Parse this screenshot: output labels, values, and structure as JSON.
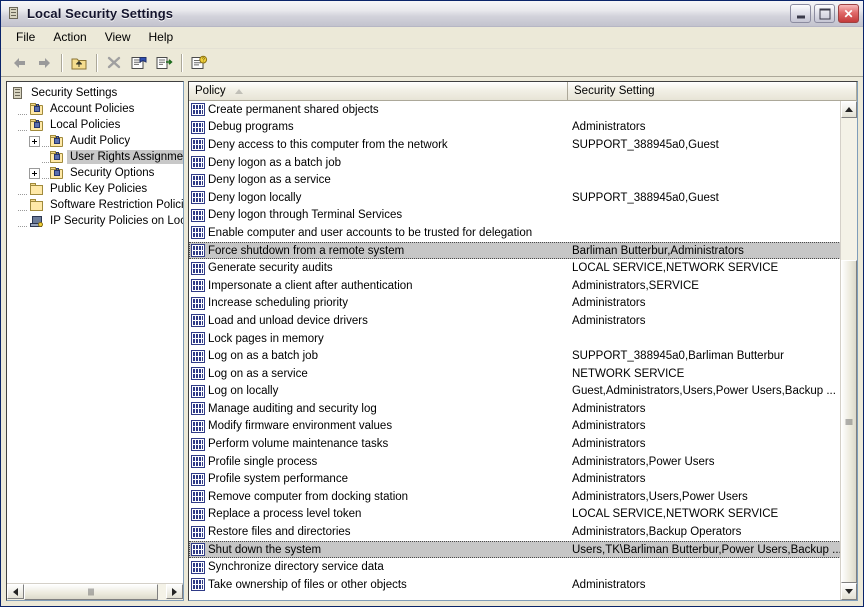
{
  "window": {
    "title": "Local Security Settings",
    "icon": "security-settings-icon",
    "buttons": {
      "minimize": "_",
      "maximize": "□",
      "close": "✕"
    }
  },
  "menu": {
    "items": [
      "File",
      "Action",
      "View",
      "Help"
    ]
  },
  "toolbar": {
    "items": [
      {
        "name": "back-icon",
        "label": "Back"
      },
      {
        "name": "forward-icon",
        "label": "Forward"
      },
      {
        "name": "up-one-level-icon",
        "label": "Up One Level"
      },
      {
        "name": "delete-icon",
        "label": "Delete"
      },
      {
        "name": "properties-icon",
        "label": "Properties"
      },
      {
        "name": "export-list-icon",
        "label": "Export List"
      },
      {
        "name": "help-icon",
        "label": "Help"
      }
    ]
  },
  "tree": {
    "nodes": [
      {
        "label": "Security Settings",
        "level": 0,
        "icon": "root-icon",
        "expander": "none",
        "selected": false
      },
      {
        "label": "Account Policies",
        "level": 1,
        "icon": "folder-lock-icon",
        "expander": "dash",
        "selected": false
      },
      {
        "label": "Local Policies",
        "level": 1,
        "icon": "folder-lock-icon",
        "expander": "dash",
        "selected": false
      },
      {
        "label": "Audit Policy",
        "level": 2,
        "icon": "folder-lock-icon",
        "expander": "plus",
        "selected": false
      },
      {
        "label": "User Rights Assignment",
        "level": 2,
        "icon": "folder-lock-icon",
        "expander": "dash",
        "selected": true
      },
      {
        "label": "Security Options",
        "level": 2,
        "icon": "folder-lock-icon",
        "expander": "plus",
        "selected": false
      },
      {
        "label": "Public Key Policies",
        "level": 1,
        "icon": "folder-icon",
        "expander": "dash",
        "selected": false
      },
      {
        "label": "Software Restriction Policies",
        "level": 1,
        "icon": "folder-icon",
        "expander": "dash",
        "selected": false
      },
      {
        "label": "IP Security Policies on Local C",
        "level": 1,
        "icon": "computer-icon",
        "expander": "dash",
        "selected": false
      }
    ]
  },
  "list": {
    "columns": [
      {
        "label": "Policy",
        "sorted": true
      },
      {
        "label": "Security Setting",
        "sorted": false
      }
    ],
    "rows": [
      {
        "policy": "Create permanent shared objects",
        "setting": "",
        "selected": false
      },
      {
        "policy": "Debug programs",
        "setting": "Administrators",
        "selected": false
      },
      {
        "policy": "Deny access to this computer from the network",
        "setting": "SUPPORT_388945a0,Guest",
        "selected": false
      },
      {
        "policy": "Deny logon as a batch job",
        "setting": "",
        "selected": false
      },
      {
        "policy": "Deny logon as a service",
        "setting": "",
        "selected": false
      },
      {
        "policy": "Deny logon locally",
        "setting": "SUPPORT_388945a0,Guest",
        "selected": false
      },
      {
        "policy": "Deny logon through Terminal Services",
        "setting": "",
        "selected": false
      },
      {
        "policy": "Enable computer and user accounts to be trusted for delegation",
        "setting": "",
        "selected": false
      },
      {
        "policy": "Force shutdown from a remote system",
        "setting": "Barliman Butterbur,Administrators",
        "selected": true
      },
      {
        "policy": "Generate security audits",
        "setting": "LOCAL SERVICE,NETWORK SERVICE",
        "selected": false
      },
      {
        "policy": "Impersonate a client after authentication",
        "setting": "Administrators,SERVICE",
        "selected": false
      },
      {
        "policy": "Increase scheduling priority",
        "setting": "Administrators",
        "selected": false
      },
      {
        "policy": "Load and unload device drivers",
        "setting": "Administrators",
        "selected": false
      },
      {
        "policy": "Lock pages in memory",
        "setting": "",
        "selected": false
      },
      {
        "policy": "Log on as a batch job",
        "setting": "SUPPORT_388945a0,Barliman Butterbur",
        "selected": false
      },
      {
        "policy": "Log on as a service",
        "setting": "NETWORK SERVICE",
        "selected": false
      },
      {
        "policy": "Log on locally",
        "setting": "Guest,Administrators,Users,Power Users,Backup ...",
        "selected": false
      },
      {
        "policy": "Manage auditing and security log",
        "setting": "Administrators",
        "selected": false
      },
      {
        "policy": "Modify firmware environment values",
        "setting": "Administrators",
        "selected": false
      },
      {
        "policy": "Perform volume maintenance tasks",
        "setting": "Administrators",
        "selected": false
      },
      {
        "policy": "Profile single process",
        "setting": "Administrators,Power Users",
        "selected": false
      },
      {
        "policy": "Profile system performance",
        "setting": "Administrators",
        "selected": false
      },
      {
        "policy": "Remove computer from docking station",
        "setting": "Administrators,Users,Power Users",
        "selected": false
      },
      {
        "policy": "Replace a process level token",
        "setting": "LOCAL SERVICE,NETWORK SERVICE",
        "selected": false
      },
      {
        "policy": "Restore files and directories",
        "setting": "Administrators,Backup Operators",
        "selected": false
      },
      {
        "policy": "Shut down the system",
        "setting": "Users,TK\\Barliman Butterbur,Power Users,Backup ...",
        "selected": true
      },
      {
        "policy": "Synchronize directory service data",
        "setting": "",
        "selected": false
      },
      {
        "policy": "Take ownership of files or other objects",
        "setting": "Administrators",
        "selected": false
      }
    ]
  },
  "scrollbars": {
    "vertical": {
      "up_arrow": "▲",
      "down_arrow": "▼"
    },
    "horizontal": {
      "left_arrow": "◀",
      "right_arrow": "▶"
    }
  },
  "colors": {
    "selection": "#c6c6c6",
    "window_face": "#ece9d8",
    "header_border": "#aca899",
    "policy_icon": "#2f3a86",
    "folder": "#ffe9a8"
  }
}
